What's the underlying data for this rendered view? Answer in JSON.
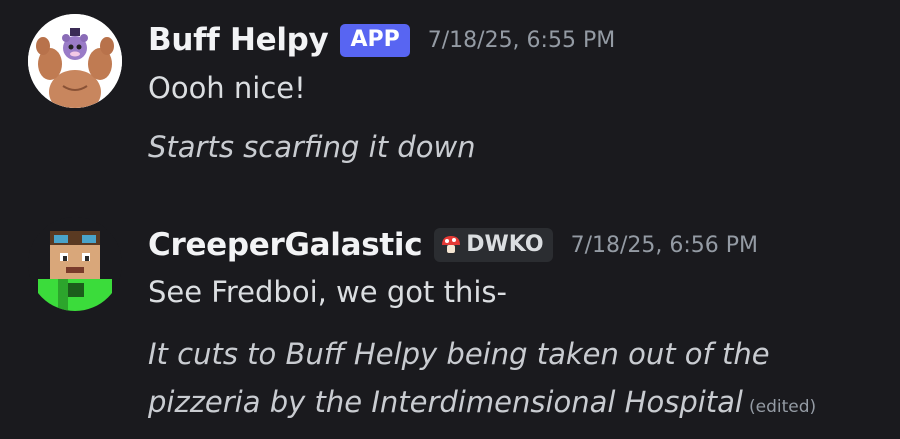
{
  "messages": [
    {
      "username": "Buff Helpy",
      "tag": "APP",
      "timestamp": "7/18/25, 6:55 PM",
      "lines": [
        "Oooh nice!",
        "Starts scarfing it down"
      ]
    },
    {
      "username": "CreeperGalastic",
      "tag": "DWKO",
      "tag_icon": "mushroom-icon",
      "timestamp": "7/18/25, 6:56 PM",
      "lines": [
        "See Fredboi, we got this-",
        "It cuts to Buff Helpy being taken out of the",
        "pizzeria by the Interdimensional Hospital"
      ],
      "edited": "(edited)"
    }
  ],
  "colors": {
    "background": "#1a1a1e",
    "app_tag": "#5865f2",
    "guild_tag": "#2b2d31",
    "timestamp": "#949ba4"
  }
}
